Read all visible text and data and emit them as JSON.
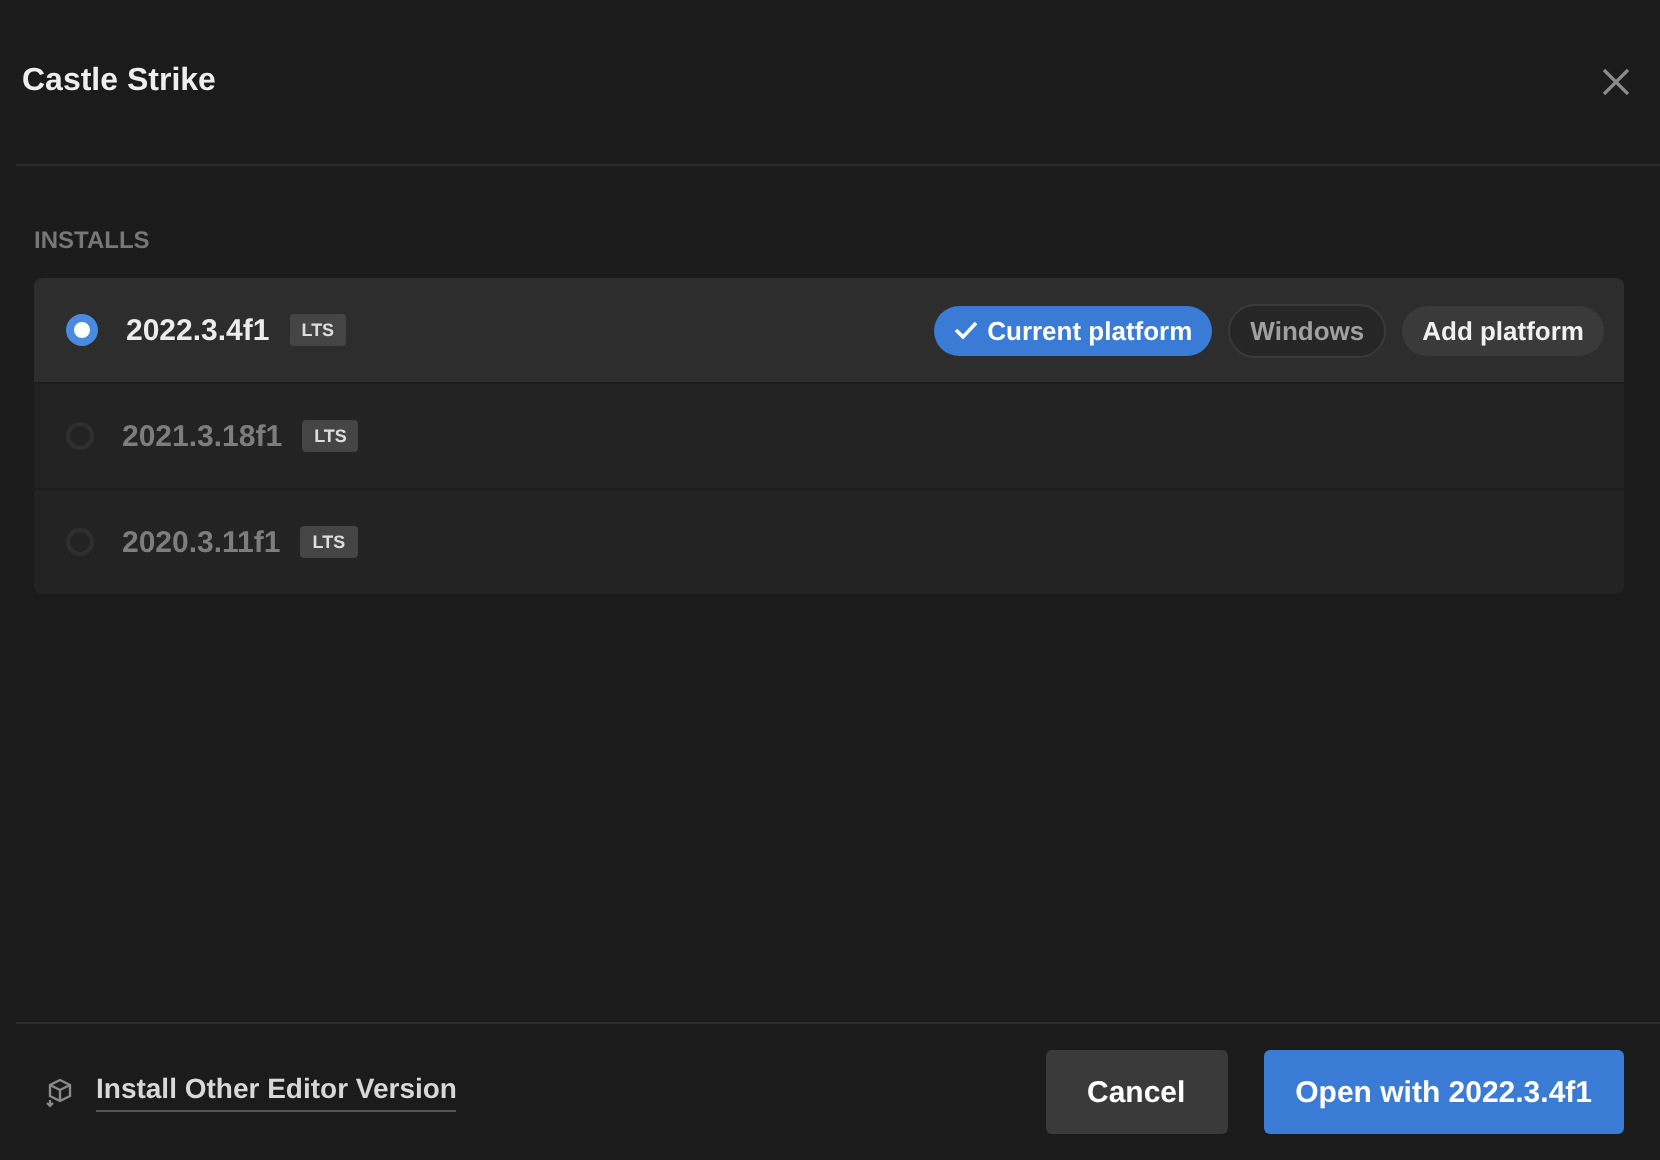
{
  "window": {
    "title": "Castle Strike"
  },
  "section_label": "INSTALLS",
  "installs": [
    {
      "version": "2022.3.4f1",
      "badge": "LTS",
      "selected": true,
      "chips": [
        {
          "kind": "current",
          "label": "Current platform"
        },
        {
          "kind": "platform",
          "label": "Windows"
        },
        {
          "kind": "add",
          "label": "Add platform"
        }
      ]
    },
    {
      "version": "2021.3.18f1",
      "badge": "LTS",
      "selected": false
    },
    {
      "version": "2020.3.11f1",
      "badge": "LTS",
      "selected": false
    }
  ],
  "footer": {
    "install_link": "Install Other Editor Version",
    "cancel": "Cancel",
    "open": "Open with 2022.3.4f1"
  }
}
